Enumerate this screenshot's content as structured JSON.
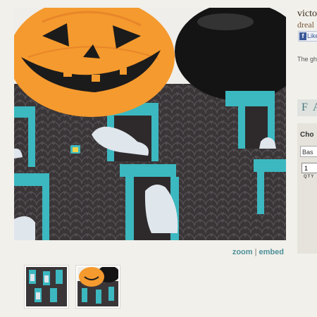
{
  "product": {
    "title": "victo",
    "store": "dreal",
    "description": "The gh",
    "tab_label": "F A",
    "choose_label": "Cho",
    "select_value": "Bas",
    "qty_value": "1",
    "qty_label": "QTY"
  },
  "facebook": {
    "like_label": "Like",
    "icon": "f"
  },
  "gallery": {
    "zoom_label": "zoom",
    "separator": "|",
    "embed_label": "embed"
  },
  "colors": {
    "fabric": "#3a3638",
    "teal": "#3cb8c0",
    "pumpkin": "#f59a2e",
    "link": "#4d8f98"
  }
}
